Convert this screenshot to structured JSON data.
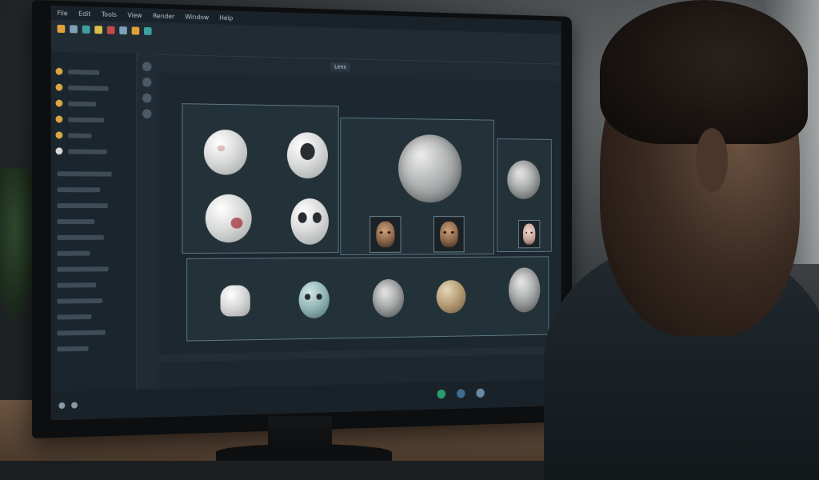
{
  "app": {
    "menu": [
      "File",
      "Edit",
      "Tools",
      "View",
      "Render",
      "Window",
      "Help"
    ],
    "tab_label": "Lens"
  },
  "panels": {
    "top_left": "",
    "bottom_left": "",
    "bottom_middle": ""
  },
  "colors": {
    "screen_bg": "#1f2a33",
    "panel_border": "#5d7a86",
    "accent_orange": "#e0a03a",
    "accent_teal": "#3ea0a0",
    "accent_red": "#c24a4a"
  },
  "icons": [
    "folder-icon",
    "render-icon",
    "settings-icon",
    "play-icon",
    "camera-icon"
  ]
}
